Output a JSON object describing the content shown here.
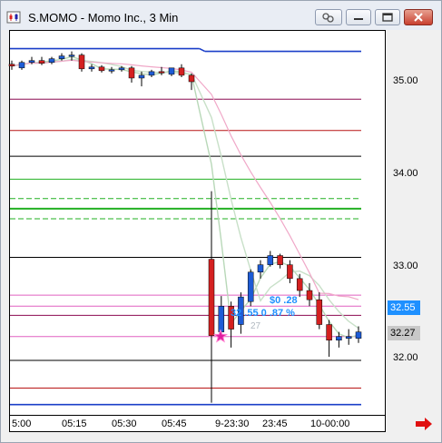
{
  "window": {
    "title": "S.MOMO - Momo Inc., 3 Min"
  },
  "price_axis": {
    "ticks": [
      "35.00",
      "34.00",
      "33.00",
      "32.00"
    ],
    "current_price_badge": "32.55",
    "last_price_badge": "32.27",
    "current_badge_color": "#1e90ff",
    "last_badge_color": "#c8c8c8"
  },
  "time_axis": {
    "labels": [
      "5:00",
      "05:15",
      "05:30",
      "05:45",
      "9-23:30",
      "23:45",
      "10-00:00"
    ]
  },
  "annotations": {
    "change_value": "$0 .28",
    "change_detail": "32 .55 0 .87 %",
    "faded_label": "27",
    "label_color": "#1e90ff"
  },
  "chart_data": {
    "type": "candlestick",
    "ylim": [
      31.7,
      35.5
    ],
    "up_color": "#1e5cd6",
    "down_color": "#d42020",
    "candles": [
      {
        "o": 35.18,
        "h": 35.22,
        "l": 35.12,
        "c": 35.16
      },
      {
        "o": 35.14,
        "h": 35.22,
        "l": 35.12,
        "c": 35.2
      },
      {
        "o": 35.2,
        "h": 35.26,
        "l": 35.18,
        "c": 35.22
      },
      {
        "o": 35.22,
        "h": 35.26,
        "l": 35.17,
        "c": 35.19
      },
      {
        "o": 35.2,
        "h": 35.26,
        "l": 35.18,
        "c": 35.24
      },
      {
        "o": 35.24,
        "h": 35.3,
        "l": 35.22,
        "c": 35.27
      },
      {
        "o": 35.27,
        "h": 35.32,
        "l": 35.22,
        "c": 35.28
      },
      {
        "o": 35.28,
        "h": 35.3,
        "l": 35.1,
        "c": 35.13
      },
      {
        "o": 35.13,
        "h": 35.18,
        "l": 35.1,
        "c": 35.15
      },
      {
        "o": 35.15,
        "h": 35.17,
        "l": 35.09,
        "c": 35.11
      },
      {
        "o": 35.11,
        "h": 35.15,
        "l": 35.08,
        "c": 35.12
      },
      {
        "o": 35.12,
        "h": 35.16,
        "l": 35.1,
        "c": 35.14
      },
      {
        "o": 35.14,
        "h": 35.16,
        "l": 34.98,
        "c": 35.03
      },
      {
        "o": 35.03,
        "h": 35.1,
        "l": 34.94,
        "c": 35.06
      },
      {
        "o": 35.06,
        "h": 35.12,
        "l": 35.04,
        "c": 35.1
      },
      {
        "o": 35.1,
        "h": 35.15,
        "l": 35.06,
        "c": 35.09
      },
      {
        "o": 35.07,
        "h": 35.14,
        "l": 35.05,
        "c": 35.14
      },
      {
        "o": 35.14,
        "h": 35.18,
        "l": 35.04,
        "c": 35.06
      },
      {
        "o": 35.06,
        "h": 35.08,
        "l": 34.9,
        "c": 34.99
      },
      {
        "o": 33.06,
        "h": 33.8,
        "l": 31.5,
        "c": 32.23
      },
      {
        "o": 32.27,
        "h": 32.66,
        "l": 32.22,
        "c": 32.55
      },
      {
        "o": 32.55,
        "h": 32.6,
        "l": 32.1,
        "c": 32.3
      },
      {
        "o": 32.35,
        "h": 32.7,
        "l": 32.25,
        "c": 32.65
      },
      {
        "o": 32.6,
        "h": 32.95,
        "l": 32.55,
        "c": 32.92
      },
      {
        "o": 32.92,
        "h": 33.05,
        "l": 32.85,
        "c": 33.0
      },
      {
        "o": 33.0,
        "h": 33.15,
        "l": 32.98,
        "c": 33.1
      },
      {
        "o": 33.1,
        "h": 33.12,
        "l": 32.96,
        "c": 33.0
      },
      {
        "o": 33.0,
        "h": 33.05,
        "l": 32.8,
        "c": 32.85
      },
      {
        "o": 32.85,
        "h": 32.9,
        "l": 32.65,
        "c": 32.72
      },
      {
        "o": 32.72,
        "h": 32.8,
        "l": 32.55,
        "c": 32.62
      },
      {
        "o": 32.62,
        "h": 32.7,
        "l": 32.3,
        "c": 32.35
      },
      {
        "o": 32.35,
        "h": 32.4,
        "l": 32.0,
        "c": 32.18
      },
      {
        "o": 32.18,
        "h": 32.27,
        "l": 32.1,
        "c": 32.22
      },
      {
        "o": 32.2,
        "h": 32.3,
        "l": 32.13,
        "c": 32.22
      },
      {
        "o": 32.2,
        "h": 32.33,
        "l": 32.15,
        "c": 32.27
      }
    ],
    "horizontal_levels": [
      {
        "y": 35.32,
        "color": "#1a3ec8",
        "width": 1.6,
        "start": 0.52
      },
      {
        "y": 34.8,
        "color": "#8b0a50",
        "width": 1
      },
      {
        "y": 34.46,
        "color": "#b81414",
        "width": 1
      },
      {
        "y": 34.18,
        "color": "#000000",
        "width": 1
      },
      {
        "y": 33.93,
        "color": "#22b022",
        "width": 1
      },
      {
        "y": 33.72,
        "color": "#22b022",
        "width": 1,
        "dash": "6,3"
      },
      {
        "y": 33.61,
        "color": "#22b022",
        "width": 2
      },
      {
        "y": 33.5,
        "color": "#22b022",
        "width": 1,
        "dash": "6,3"
      },
      {
        "y": 33.08,
        "color": "#000000",
        "width": 1
      },
      {
        "y": 32.67,
        "color": "#e060c0",
        "width": 1
      },
      {
        "y": 32.55,
        "color": "#e060c0",
        "width": 1
      },
      {
        "y": 32.45,
        "color": "#8b0a50",
        "width": 1
      },
      {
        "y": 32.22,
        "color": "#e060c0",
        "width": 1
      },
      {
        "y": 31.96,
        "color": "#000000",
        "width": 1
      },
      {
        "y": 31.66,
        "color": "#b81414",
        "width": 1
      },
      {
        "y": 31.48,
        "color": "#1a3ec8",
        "width": 1.6
      }
    ]
  }
}
